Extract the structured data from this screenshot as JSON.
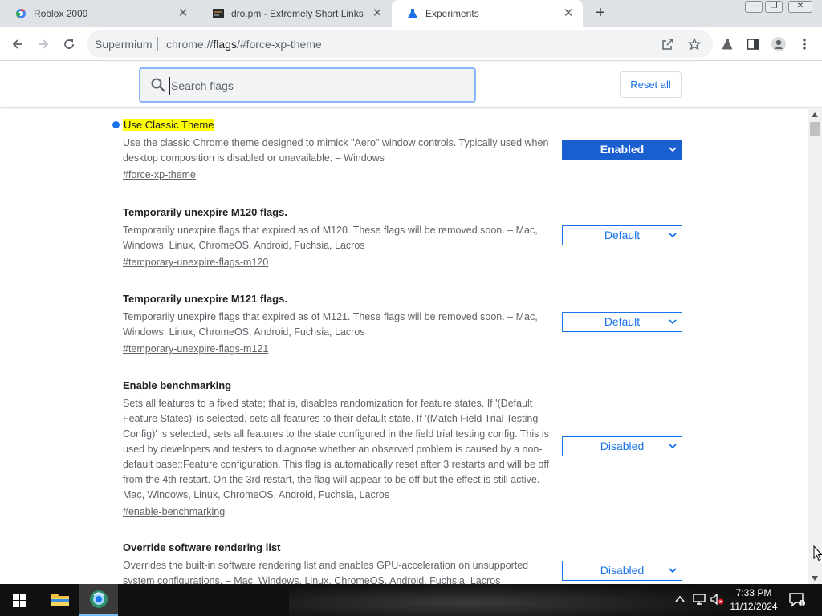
{
  "tabs": [
    {
      "title": "Roblox 2009",
      "icon": "chrome-globe-icon"
    },
    {
      "title": "dro.pm - Extremely Short Links",
      "icon": "site-favicon-icon"
    },
    {
      "title": "Experiments",
      "icon": "flask-icon"
    }
  ],
  "newtab_label": "+",
  "window": {
    "minimize": "—",
    "restore": "❐",
    "close": "✕"
  },
  "toolbar": {
    "brand": "Supermium",
    "url_scheme": "chrome://",
    "url_domain": "flags",
    "url_path": "/#force-xp-theme"
  },
  "search": {
    "placeholder": "Search flags",
    "reset_label": "Reset all"
  },
  "flags": [
    {
      "title": "Use Classic Theme",
      "highlighted": true,
      "modified": true,
      "desc": "Use the classic Chrome theme designed to mimick \"Aero\" window controls. Typically used when desktop composition is disabled or unavailable. – Windows",
      "link": "#force-xp-theme",
      "value": "Enabled"
    },
    {
      "title": "Temporarily unexpire M120 flags.",
      "desc": "Temporarily unexpire flags that expired as of M120. These flags will be removed soon. – Mac, Windows, Linux, ChromeOS, Android, Fuchsia, Lacros",
      "link": "#temporary-unexpire-flags-m120",
      "value": "Default"
    },
    {
      "title": "Temporarily unexpire M121 flags.",
      "desc": "Temporarily unexpire flags that expired as of M121. These flags will be removed soon. – Mac, Windows, Linux, ChromeOS, Android, Fuchsia, Lacros",
      "link": "#temporary-unexpire-flags-m121",
      "value": "Default"
    },
    {
      "title": "Enable benchmarking",
      "desc": "Sets all features to a fixed state; that is, disables randomization for feature states. If '(Default Feature States)' is selected, sets all features to their default state. If '(Match Field Trial Testing Config)' is selected, sets all features to the state configured in the field trial testing config. This is used by developers and testers to diagnose whether an observed problem is caused by a non-default base::Feature configuration. This flag is automatically reset after 3 restarts and will be off from the 4th restart. On the 3rd restart, the flag will appear to be off but the effect is still active. – Mac, Windows, Linux, ChromeOS, Android, Fuchsia, Lacros",
      "link": "#enable-benchmarking",
      "value": "Disabled"
    },
    {
      "title": "Override software rendering list",
      "desc": "Overrides the built-in software rendering list and enables GPU-acceleration on unsupported system configurations. – Mac, Windows, Linux, ChromeOS, Android, Fuchsia, Lacros",
      "link": "",
      "value": "Disabled"
    }
  ],
  "taskbar": {
    "clock_time": "7:33 PM",
    "clock_date": "11/12/2024",
    "apps": [
      "file-explorer-icon",
      "browser-icon"
    ]
  },
  "colors": {
    "accent": "#1a73e8",
    "enabled_bg": "#1a5fd0",
    "highlight": "#ffff00"
  }
}
